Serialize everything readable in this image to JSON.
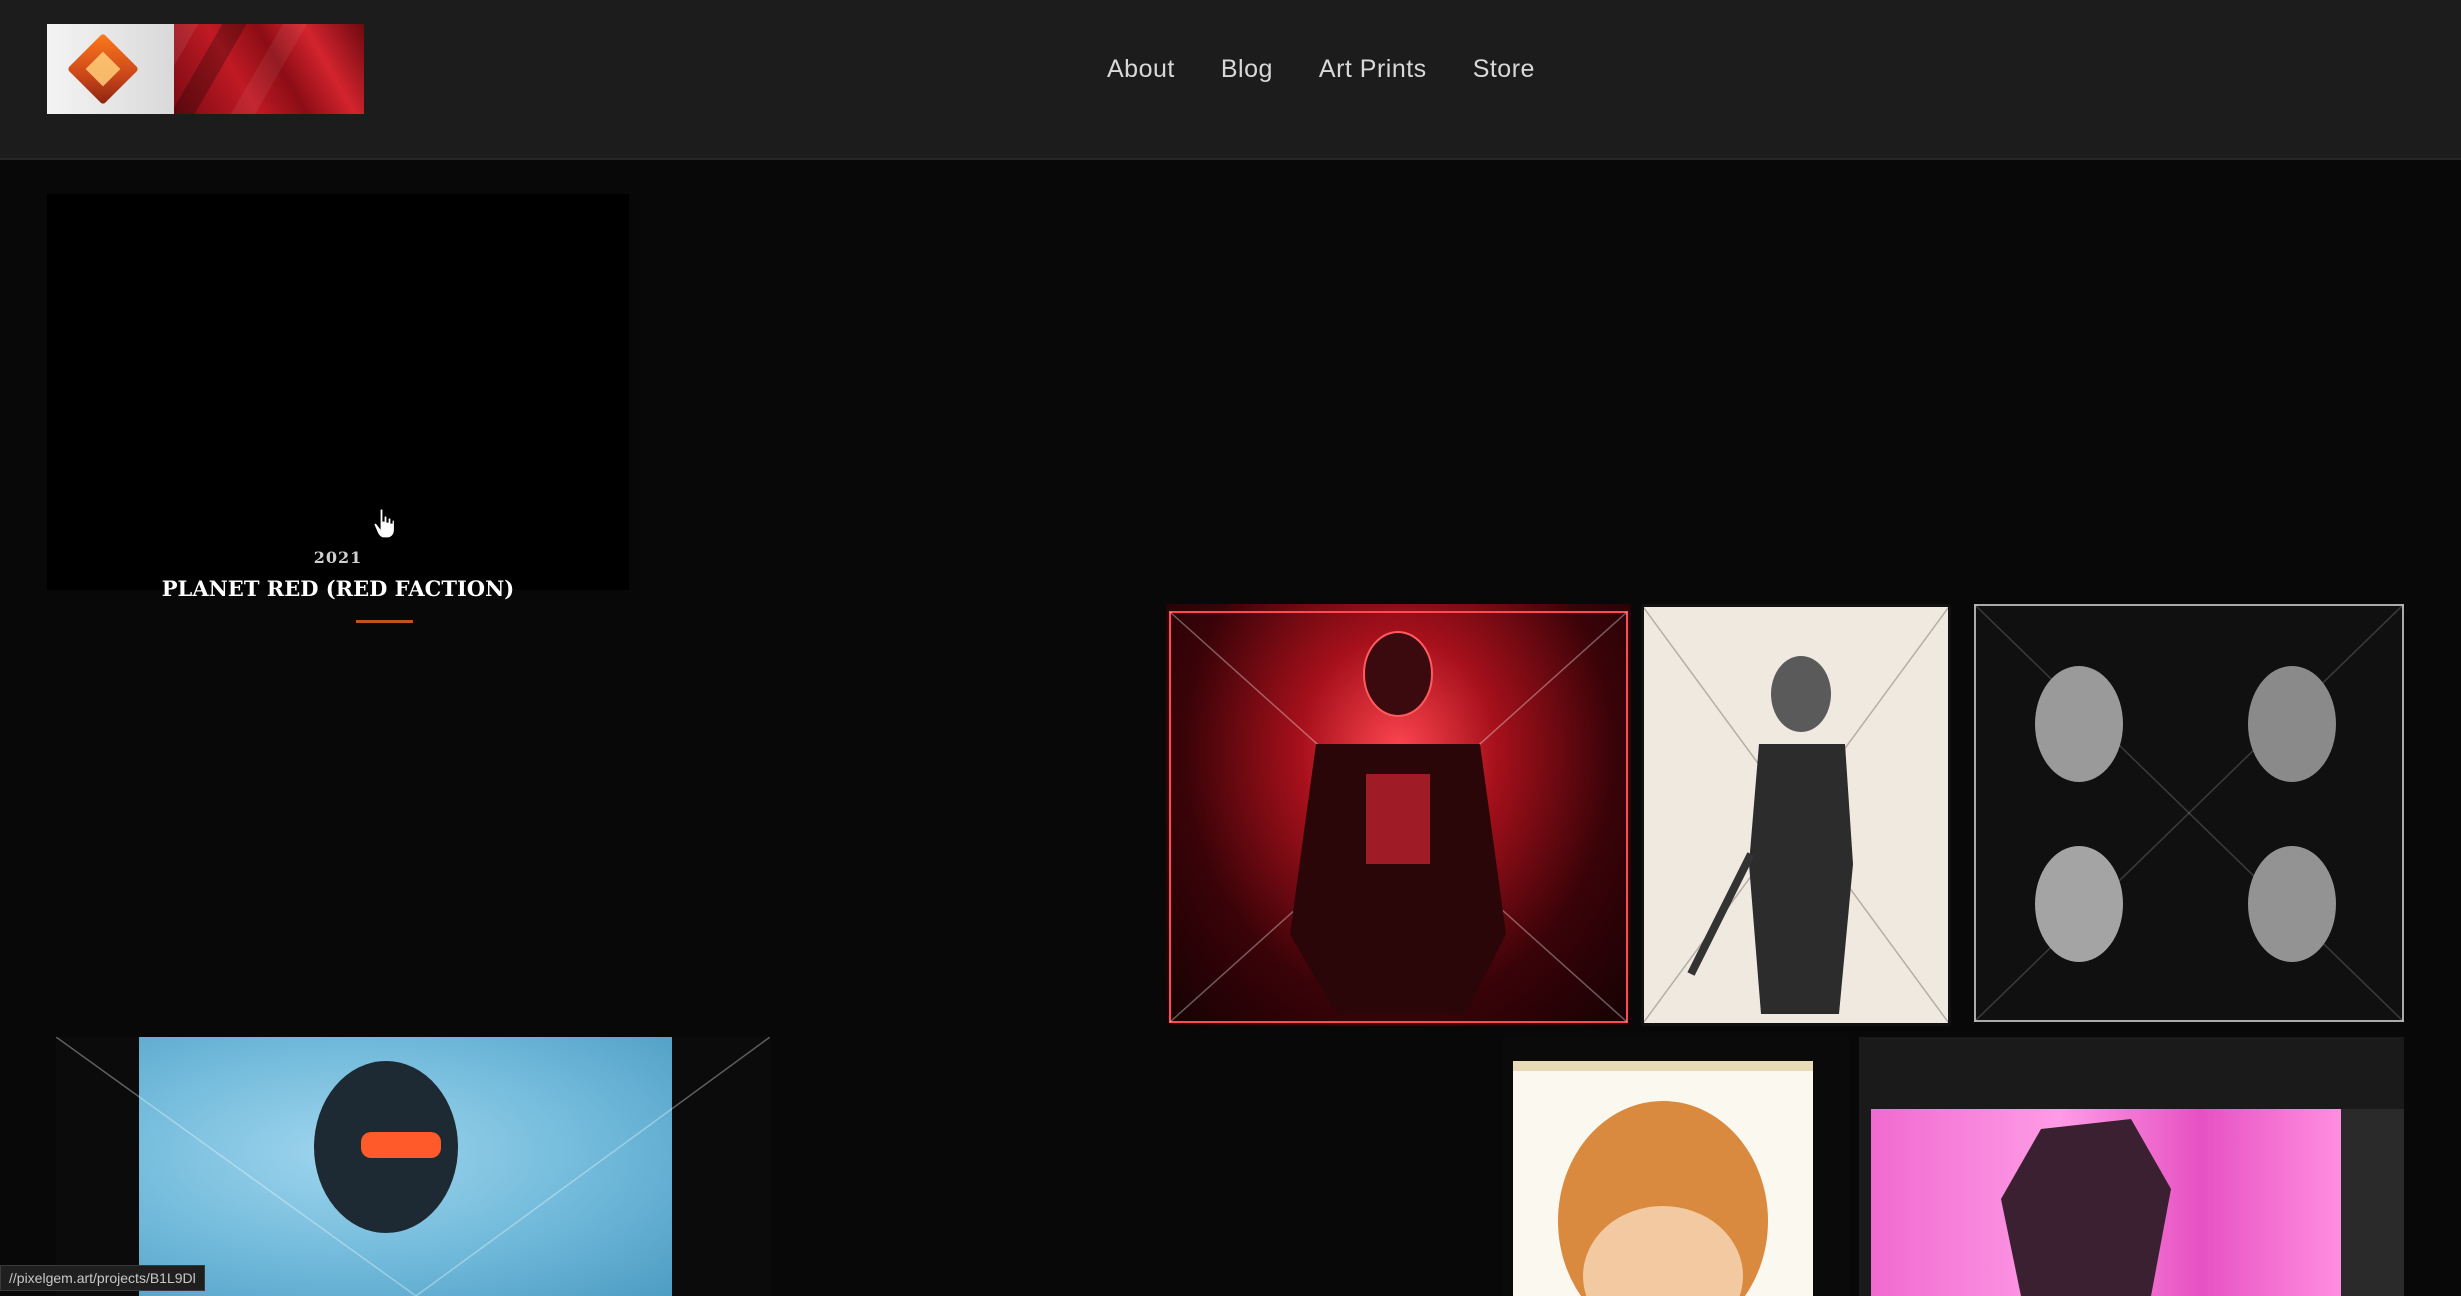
{
  "header": {
    "nav": [
      {
        "label": "About"
      },
      {
        "label": "Blog"
      },
      {
        "label": "Art Prints"
      },
      {
        "label": "Store"
      }
    ]
  },
  "feature": {
    "year": "2021",
    "title": "PLANET RED (RED FACTION)"
  },
  "status_bar": {
    "url": "//pixelgem.art/projects/B1L9Dl"
  },
  "colors": {
    "header_bg": "#1c1c1c",
    "page_bg": "#080808",
    "accent_underline": "#c0531c"
  }
}
